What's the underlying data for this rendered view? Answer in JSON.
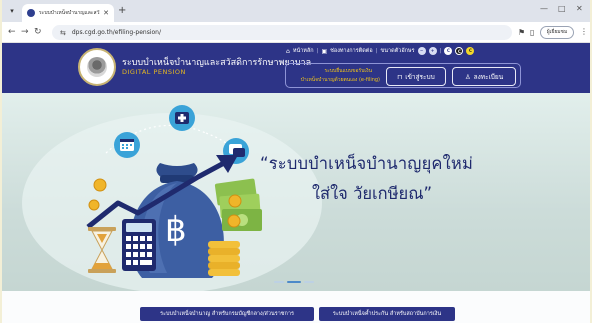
{
  "browser": {
    "tab_title": "ระบบบำเหน็จบำนาญและสวัสดิการ",
    "url": "dps.cgd.go.th/efiling-pension/",
    "profile_label": "ผู้เยี่ยมชม",
    "new_tab_glyph": "+",
    "close_glyph": "✕",
    "minimize_glyph": "—",
    "restore_glyph": "□",
    "win_close_glyph": "✕"
  },
  "header": {
    "brand_th": "ระบบบำเหน็จบำนาญและสวัสดิการรักษาพยาบาล",
    "brand_en": "DIGITAL PENSION",
    "links": {
      "home": "หน้าหลัก",
      "contact": "ช่องทางการติดต่อ",
      "font_size": "ขนาดตัวอักษร",
      "font_minus": "−",
      "font_plus": "+",
      "contrast_a": "C",
      "contrast_b": "C",
      "contrast_c": "C"
    },
    "efiling_title": "ระบบยื่นแบบขอรับเงิน",
    "efiling_sub": "บำเหน็จบำนาญด้วยตนเอง (e-filing)",
    "login_label": "เข้าสู่ระบบ",
    "register_label": "ลงทะเบียน"
  },
  "hero": {
    "headline_line1": "“ระบบบำเหน็จบำนาญยุคใหม่",
    "headline_line2": "ใส่ใจ วัยเกษียณ”",
    "bag_symbol": "฿",
    "slide_count": 3,
    "active_slide": 2
  },
  "bottom": {
    "btn_pension_gov": "ระบบบำเหน็จบำนาญ สำหรับกรมบัญชีกลาง/ส่วนราชการ",
    "btn_pension_fund": "ระบบบำเหน็จค้ำประกัน สำหรับสถาบันการเงิน"
  },
  "colors": {
    "header_bg": "#2d3487",
    "accent_gold": "#e6b820",
    "headline": "#1f2a6e",
    "hero_bg": "#dfece9"
  }
}
